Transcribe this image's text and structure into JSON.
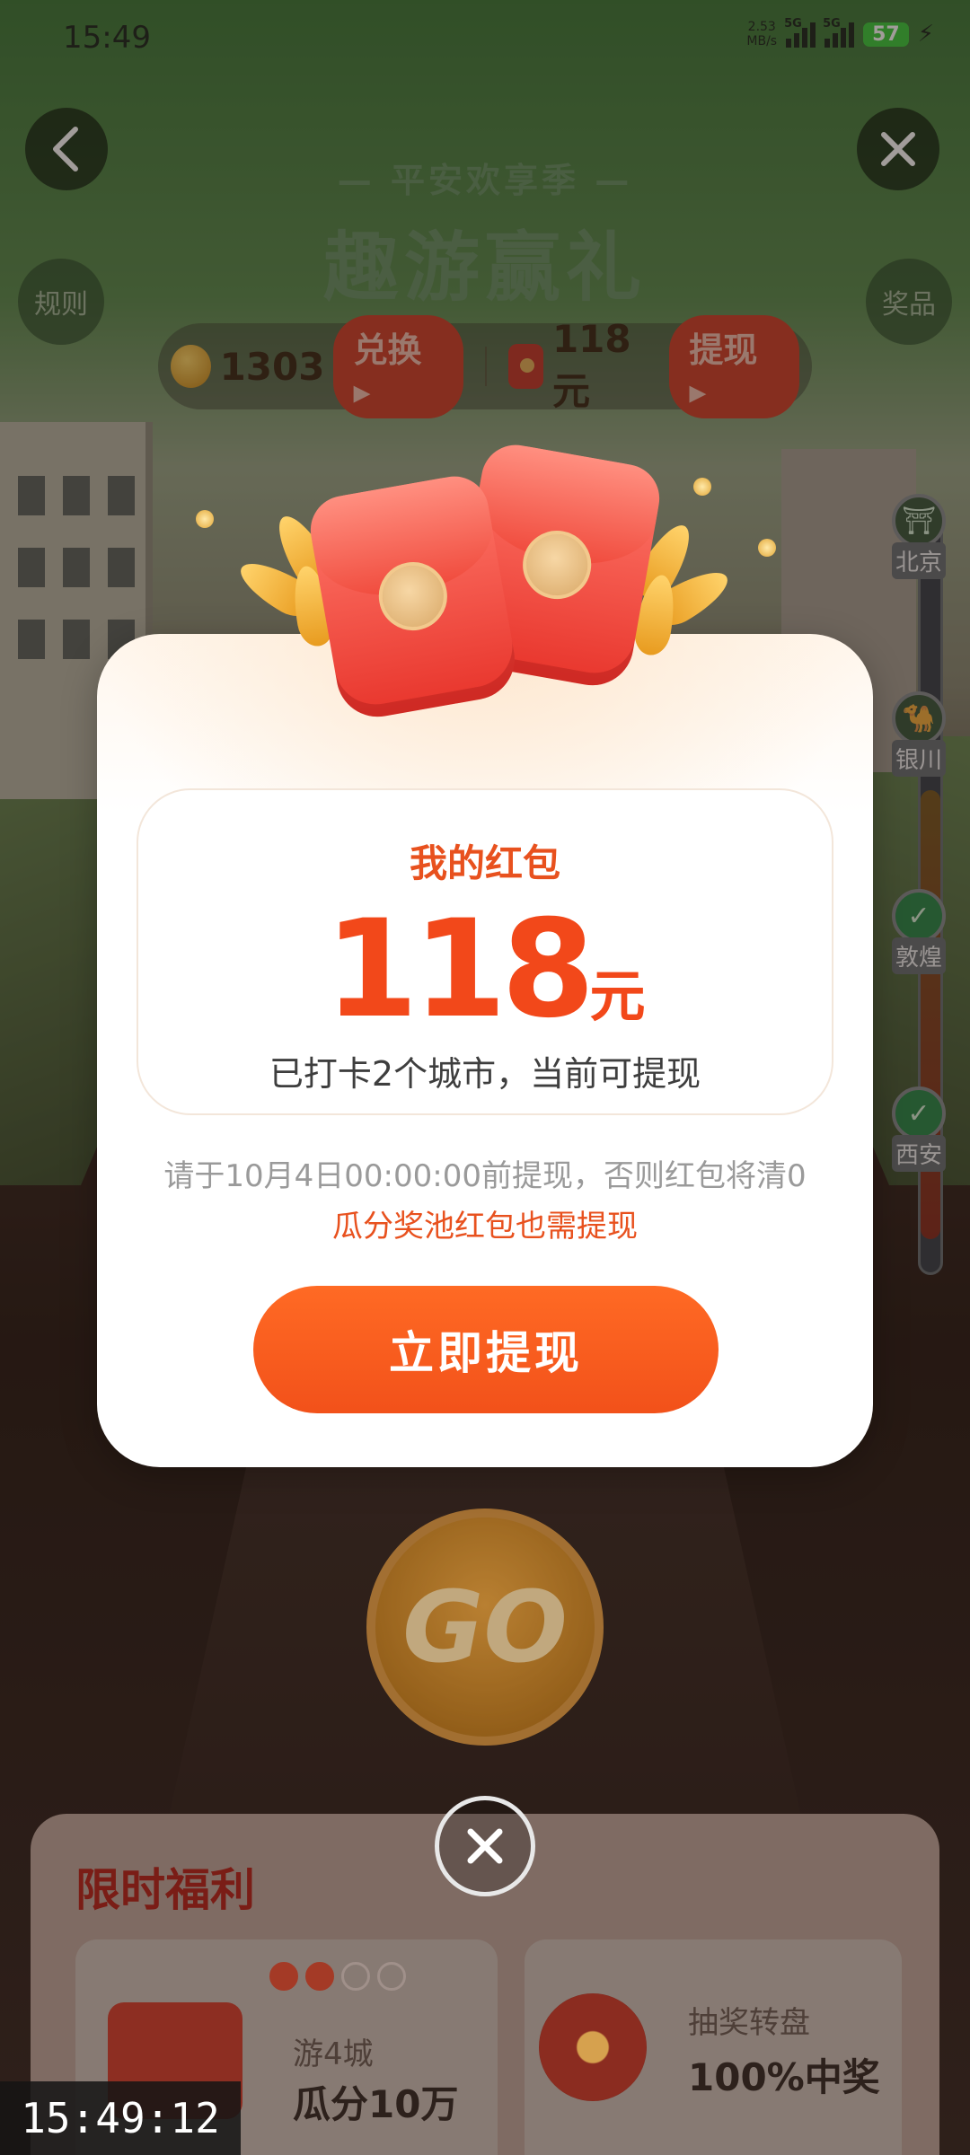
{
  "status_bar": {
    "time": "15:49",
    "net_speed_value": "2.53",
    "net_speed_unit": "MB/s",
    "network_1": "5G",
    "network_2": "5G",
    "battery": "57"
  },
  "header": {
    "subtitle": "— 平安欢享季 —",
    "title": "趣游赢礼",
    "rules_label": "规则",
    "prizes_label": "奖品"
  },
  "balance": {
    "coins": "1303",
    "exchange_label": "兑换 ▸",
    "cash": "118元",
    "withdraw_label": "提现 ▸"
  },
  "cities": [
    {
      "name": "北京",
      "checked": false
    },
    {
      "name": "银川",
      "checked": false
    },
    {
      "name": "敦煌",
      "checked": true
    },
    {
      "name": "西安",
      "checked": true
    }
  ],
  "go_label": "GO",
  "welfare": {
    "title": "限时福利",
    "card1_sub": "游4城",
    "card1_main": "瓜分10万",
    "card2_sub": "抽奖转盘",
    "card2_main": "100%中奖",
    "progress_done": 2,
    "progress_total": 4
  },
  "modal": {
    "label": "我的红包",
    "amount": "118",
    "unit": "元",
    "desc": "已打卡2个城市，当前可提现",
    "deadline": "请于10月4日00:00:00前提现，否则红包将清0",
    "pool_note": "瓜分奖池红包也需提现",
    "button": "立即提现"
  },
  "overlay_clock": "15:49:12",
  "colors": {
    "accent": "#f2511a",
    "label_orange": "#e8511e",
    "packet_red": "#e8352c"
  },
  "icons": {
    "back": "chevron-left-icon",
    "close": "close-icon",
    "coin": "coin-icon",
    "redpack": "red-packet-icon",
    "check": "check-icon"
  }
}
